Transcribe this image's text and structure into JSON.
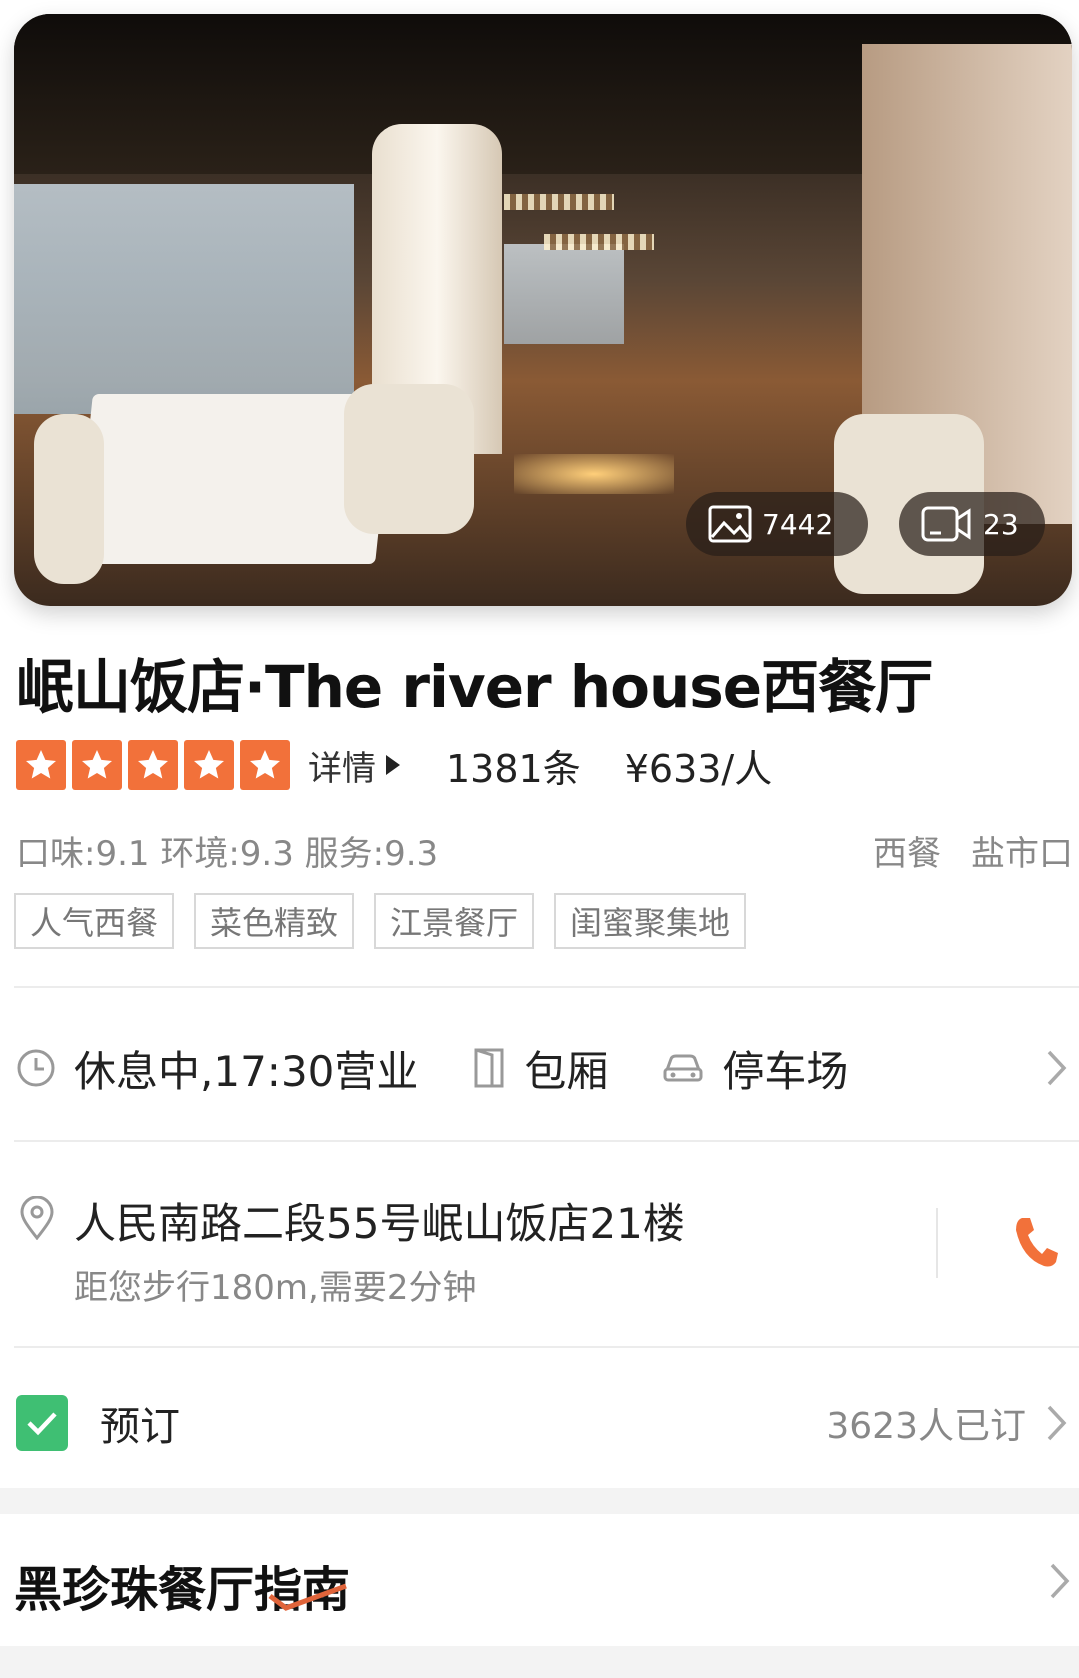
{
  "media": {
    "photo_count": "7442",
    "video_count": "23"
  },
  "restaurant": {
    "name": "岷山饭店·The river house西餐厅",
    "rating_stars": 5,
    "detail_label": "详情",
    "review_count": "1381条",
    "price": "¥633/人",
    "scores": "口味:9.1  环境:9.3  服务:9.3",
    "category": "西餐",
    "area": "盐市口",
    "tags": [
      "人气西餐",
      "菜色精致",
      "江景餐厅",
      "闺蜜聚集地"
    ]
  },
  "info": {
    "hours": "休息中,17:30营业",
    "private_room": "包厢",
    "parking": "停车场"
  },
  "address": {
    "line": "人民南路二段55号岷山饭店21楼",
    "distance": "距您步行180m,需要2分钟"
  },
  "booking": {
    "label": "预订",
    "count": "3623人已订"
  },
  "guide": {
    "title": "黑珍珠餐厅指南"
  },
  "colors": {
    "star": "#f2713a",
    "phone": "#f2713a",
    "check": "#3fbf73"
  }
}
